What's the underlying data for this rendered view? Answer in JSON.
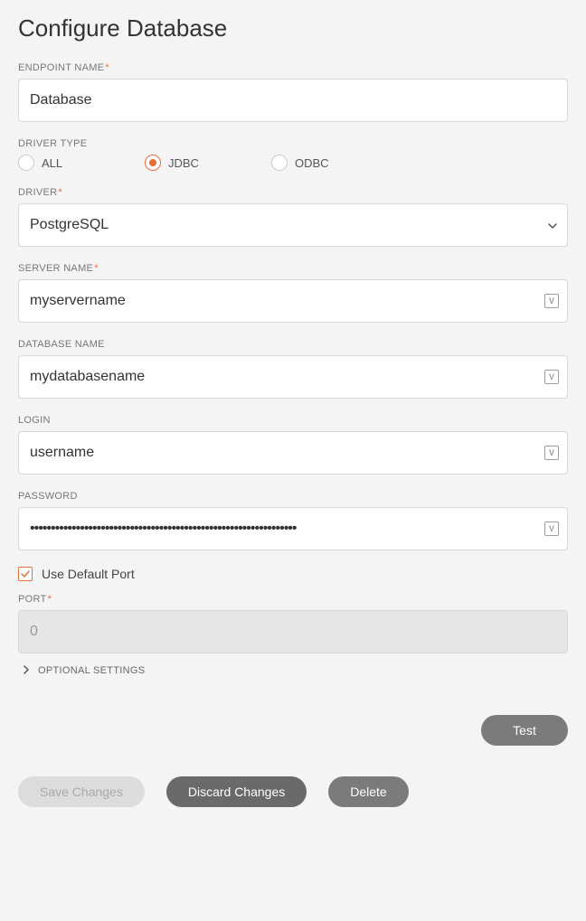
{
  "title": "Configure Database",
  "fields": {
    "endpoint_name": {
      "label": "ENDPOINT NAME",
      "value": "Database",
      "required": true
    },
    "driver_type": {
      "label": "DRIVER TYPE",
      "options": [
        {
          "label": "ALL",
          "selected": false
        },
        {
          "label": "JDBC",
          "selected": true
        },
        {
          "label": "ODBC",
          "selected": false
        }
      ]
    },
    "driver": {
      "label": "DRIVER",
      "value": "PostgreSQL",
      "required": true
    },
    "server_name": {
      "label": "SERVER NAME",
      "value": "myservername",
      "required": true
    },
    "database_name": {
      "label": "DATABASE NAME",
      "value": "mydatabasename",
      "required": false
    },
    "login": {
      "label": "LOGIN",
      "value": "username",
      "required": false
    },
    "password": {
      "label": "PASSWORD",
      "value": "••••••••••••••••••••••••••••••••••••••••••••••••••••••••••••••••",
      "required": false
    },
    "use_default_port": {
      "label": "Use Default Port",
      "checked": true
    },
    "port": {
      "label": "PORT",
      "value": "0",
      "required": true,
      "disabled": true
    }
  },
  "optional_settings_label": "OPTIONAL SETTINGS",
  "buttons": {
    "test": "Test",
    "save": "Save Changes",
    "discard": "Discard Changes",
    "delete": "Delete"
  },
  "required_marker": "*",
  "icons": {
    "variable_badge": "V"
  }
}
